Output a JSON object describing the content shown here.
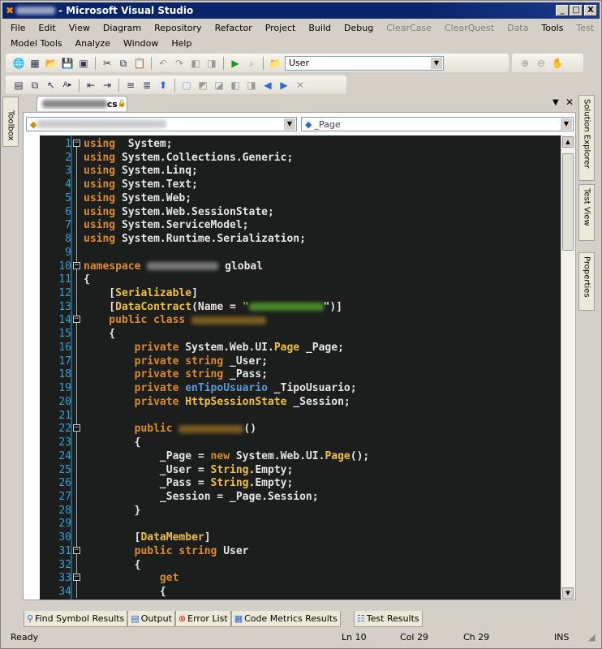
{
  "window": {
    "title": "- Microsoft Visual Studio",
    "controls": [
      "_",
      "□",
      "X"
    ]
  },
  "menu": {
    "row1": [
      "File",
      "Edit",
      "View",
      "Diagram",
      "Repository",
      "Refactor",
      "Project",
      "Build",
      "Debug",
      "ClearCase",
      "ClearQuest",
      "Data",
      "Tools",
      "Test"
    ],
    "row2": [
      "Model Tools",
      "Analyze",
      "Window",
      "Help"
    ]
  },
  "toolbar": {
    "find_combo_value": "User"
  },
  "left_panel": {
    "toolbox_label": "Toolbox"
  },
  "right_panel": {
    "items": [
      "Solution Explorer",
      "Test View",
      "Properties"
    ]
  },
  "document_tab": {
    "ext": "cs"
  },
  "nav": {
    "member_value": "_Page"
  },
  "code": {
    "lines": [
      {
        "n": "1",
        "fold": "open",
        "t": [
          [
            "k",
            "using"
          ],
          [
            "",
            "  System;"
          ]
        ]
      },
      {
        "n": "2",
        "t": [
          [
            "k",
            "using"
          ],
          [
            "",
            " System.Collections.Generic;"
          ]
        ]
      },
      {
        "n": "3",
        "t": [
          [
            "k",
            "using"
          ],
          [
            "",
            " System.Linq;"
          ]
        ]
      },
      {
        "n": "4",
        "t": [
          [
            "k",
            "using"
          ],
          [
            "",
            " System.Text;"
          ]
        ]
      },
      {
        "n": "5",
        "t": [
          [
            "k",
            "using"
          ],
          [
            "",
            " System.Web;"
          ]
        ]
      },
      {
        "n": "6",
        "t": [
          [
            "k",
            "using"
          ],
          [
            "",
            " System.Web.SessionState;"
          ]
        ]
      },
      {
        "n": "7",
        "t": [
          [
            "k",
            "using"
          ],
          [
            "",
            " System.ServiceModel;"
          ]
        ]
      },
      {
        "n": "8",
        "t": [
          [
            "k",
            "using"
          ],
          [
            "",
            " System.Runtime.Serialization;"
          ]
        ]
      },
      {
        "n": "9",
        "t": []
      },
      {
        "n": "10",
        "fold": "open",
        "t": [
          [
            "k",
            "namespace"
          ],
          [
            "",
            " "
          ],
          [
            "bz1",
            ""
          ],
          [
            "",
            " global"
          ]
        ]
      },
      {
        "n": "11",
        "t": [
          [
            "",
            "{"
          ]
        ]
      },
      {
        "n": "12",
        "t": [
          [
            "",
            "    ["
          ],
          [
            "y",
            "Serializable"
          ],
          [
            "",
            "]"
          ]
        ]
      },
      {
        "n": "13",
        "t": [
          [
            "",
            "    ["
          ],
          [
            "y",
            "DataContract"
          ],
          [
            "",
            "(Name = "
          ],
          [
            "s",
            "\""
          ],
          [
            "bz2",
            ""
          ],
          [
            "",
            "\")]"
          ]
        ]
      },
      {
        "n": "14",
        "fold": "open",
        "t": [
          [
            "k",
            "    public class"
          ],
          [
            "",
            " "
          ],
          [
            "bz2",
            ""
          ]
        ]
      },
      {
        "n": "15",
        "t": [
          [
            "",
            "    {"
          ]
        ]
      },
      {
        "n": "16",
        "t": [
          [
            "k",
            "        private"
          ],
          [
            "",
            " System.Web.UI."
          ],
          [
            "y",
            "Page"
          ],
          [
            "",
            " _Page;"
          ]
        ]
      },
      {
        "n": "17",
        "t": [
          [
            "k",
            "        private string"
          ],
          [
            "",
            " _User;"
          ]
        ]
      },
      {
        "n": "18",
        "t": [
          [
            "k",
            "        private string"
          ],
          [
            "",
            " _Pass;"
          ]
        ]
      },
      {
        "n": "19",
        "t": [
          [
            "k",
            "        private"
          ],
          [
            "",
            " "
          ],
          [
            "bl",
            "enTipoUsuario"
          ],
          [
            "",
            " _TipoUsuario;"
          ]
        ]
      },
      {
        "n": "20",
        "t": [
          [
            "k",
            "        private"
          ],
          [
            "",
            " "
          ],
          [
            "y",
            "HttpSessionState"
          ],
          [
            "",
            " _Session;"
          ]
        ]
      },
      {
        "n": "21",
        "t": []
      },
      {
        "n": "22",
        "fold": "open",
        "t": [
          [
            "k",
            "        public"
          ],
          [
            "",
            " "
          ],
          [
            "bz3",
            ""
          ],
          [
            "",
            "()"
          ]
        ]
      },
      {
        "n": "23",
        "t": [
          [
            "",
            "        {"
          ]
        ]
      },
      {
        "n": "24",
        "t": [
          [
            "",
            "            _Page = "
          ],
          [
            "k",
            "new"
          ],
          [
            "",
            " System.Web.UI."
          ],
          [
            "y",
            "Page"
          ],
          [
            "",
            "();"
          ]
        ]
      },
      {
        "n": "25",
        "t": [
          [
            "",
            "            _User = "
          ],
          [
            "y",
            "String"
          ],
          [
            "",
            ".Empty;"
          ]
        ]
      },
      {
        "n": "26",
        "t": [
          [
            "",
            "            _Pass = "
          ],
          [
            "y",
            "String"
          ],
          [
            "",
            ".Empty;"
          ]
        ]
      },
      {
        "n": "27",
        "t": [
          [
            "",
            "            _Session = _Page.Session;"
          ]
        ]
      },
      {
        "n": "28",
        "t": [
          [
            "",
            "        }"
          ]
        ]
      },
      {
        "n": "29",
        "t": []
      },
      {
        "n": "30",
        "t": [
          [
            "",
            "        ["
          ],
          [
            "y",
            "DataMember"
          ],
          [
            "",
            "]"
          ]
        ]
      },
      {
        "n": "31",
        "fold": "open",
        "t": [
          [
            "k",
            "        public string"
          ],
          [
            "",
            " User"
          ]
        ]
      },
      {
        "n": "32",
        "t": [
          [
            "",
            "        {"
          ]
        ]
      },
      {
        "n": "33",
        "fold": "open",
        "t": [
          [
            "k",
            "            get"
          ]
        ]
      },
      {
        "n": "34",
        "t": [
          [
            "",
            "            {"
          ]
        ]
      }
    ]
  },
  "bottom_tabs": [
    "Find Symbol Results",
    "Output",
    "Error List",
    "Code Metrics Results",
    "Test Results"
  ],
  "status": {
    "text": "Ready",
    "ln": "Ln 10",
    "col": "Col 29",
    "ch": "Ch 29",
    "mode": "INS"
  }
}
